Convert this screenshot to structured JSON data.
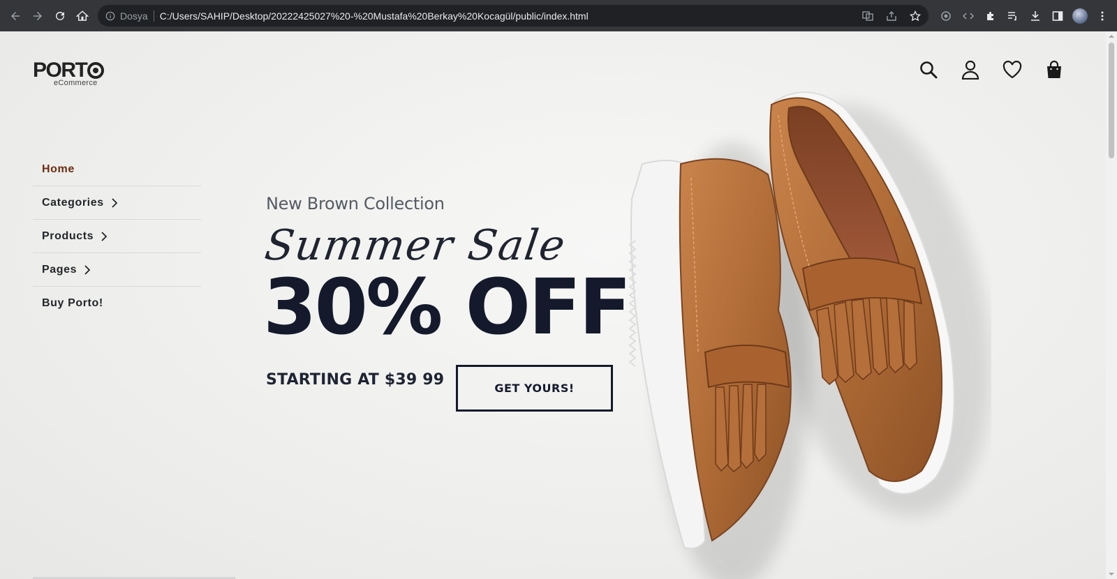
{
  "browser": {
    "scheme_label": "Dosya",
    "url": "C:/Users/SAHIP/Desktop/20222425027%20-%20Mustafa%20Berkay%20Kocagül/public/index.html"
  },
  "site": {
    "logo_text": "PORT",
    "logo_sub": "eCommerce"
  },
  "menu": [
    {
      "label": "Home",
      "active": true,
      "has_children": false
    },
    {
      "label": "Categories",
      "active": false,
      "has_children": true
    },
    {
      "label": "Products",
      "active": false,
      "has_children": true
    },
    {
      "label": "Pages",
      "active": false,
      "has_children": true
    },
    {
      "label": "Buy Porto!",
      "active": false,
      "has_children": false
    }
  ],
  "header_icons": [
    "search-icon",
    "user-icon",
    "heart-icon",
    "bag-icon"
  ],
  "hero": {
    "subheading": "New Brown Collection",
    "script_title": "Summer Sale",
    "headline": "30% OFF",
    "starting": "STARTING AT $39 99",
    "cta": "GET YOURS!"
  },
  "colors": {
    "active_menu": "#6b2d12",
    "headline": "#141a2c",
    "shoe_leather": "#b5733f"
  }
}
